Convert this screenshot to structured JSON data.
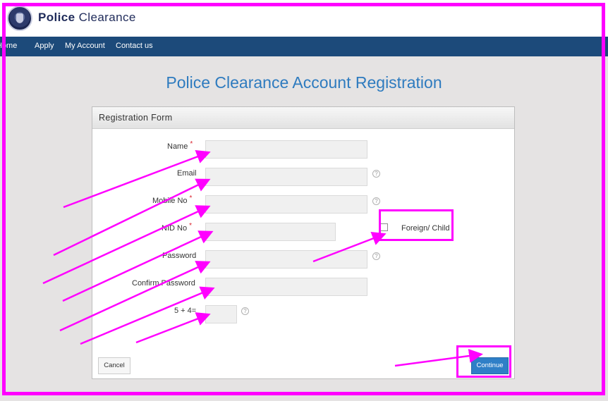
{
  "header": {
    "brand_bold": "Police",
    "brand_rest": " Clearance"
  },
  "nav": {
    "home": "Home",
    "apply": "Apply",
    "my_account": "My Account",
    "contact_us": "Contact us"
  },
  "page": {
    "title": "Police Clearance Account Registration"
  },
  "form": {
    "panel_title": "Registration Form",
    "name_label": "Name",
    "email_label": "Email",
    "mobile_label": "Mobile No",
    "nid_label": "NID No",
    "foreign_label": "Foreign/ Child",
    "password_label": "Password",
    "confirm_password_label": "Confirm Password",
    "captcha_label": "5 + 4=",
    "required_mark": "*",
    "help_mark": "?",
    "name_value": "",
    "email_value": "",
    "mobile_value": "",
    "nid_value": "",
    "password_value": "",
    "confirm_password_value": "",
    "captcha_value": "",
    "foreign_checked": false
  },
  "buttons": {
    "cancel": "Cancel",
    "continue": "Continue"
  },
  "colors": {
    "nav_bg": "#1c4a7a",
    "title_blue": "#2e7bbf",
    "continue_bg": "#2f7fc7",
    "annotation": "#ff00ff",
    "required_red": "#d9232e"
  },
  "icons": [
    "police-emblem-logo",
    "help-circle-icon",
    "checkbox",
    "annotation-arrow"
  ]
}
